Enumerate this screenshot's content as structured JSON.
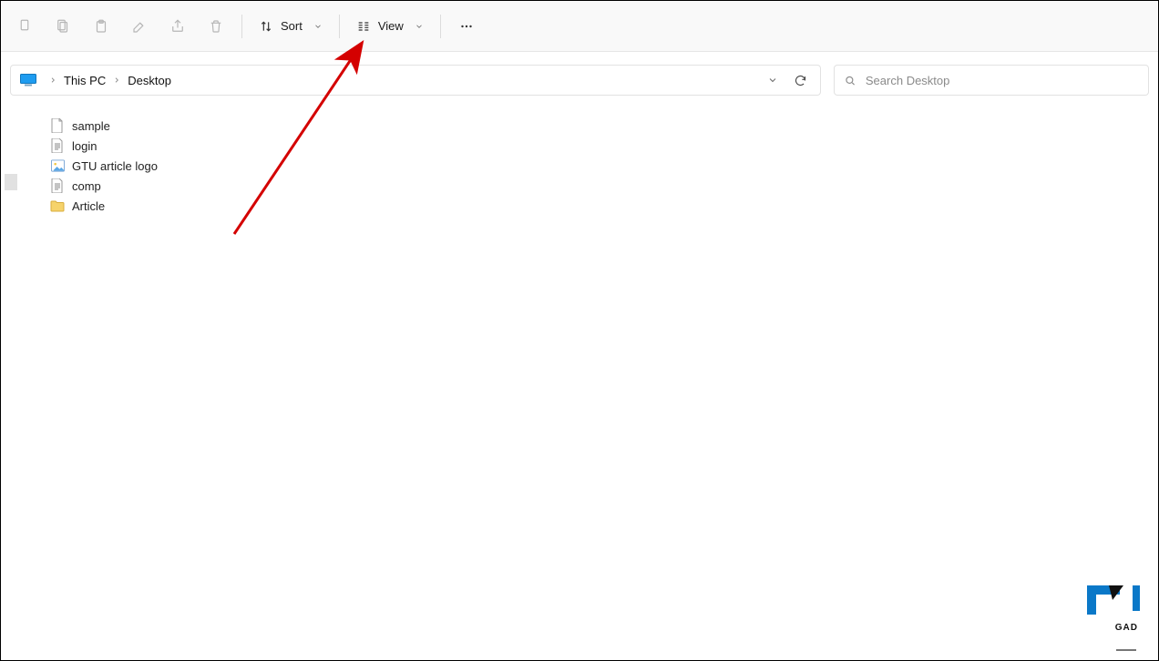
{
  "toolbar": {
    "sort_label": "Sort",
    "view_label": "View"
  },
  "breadcrumb": {
    "items": [
      "This PC",
      "Desktop"
    ]
  },
  "search": {
    "placeholder": "Search Desktop"
  },
  "files": [
    {
      "name": "sample",
      "icon": "file-blank"
    },
    {
      "name": "login",
      "icon": "text-file"
    },
    {
      "name": "GTU article logo",
      "icon": "image-file"
    },
    {
      "name": "comp",
      "icon": "text-file"
    },
    {
      "name": "Article",
      "icon": "folder"
    }
  ],
  "watermark": {
    "text": "GAD"
  }
}
